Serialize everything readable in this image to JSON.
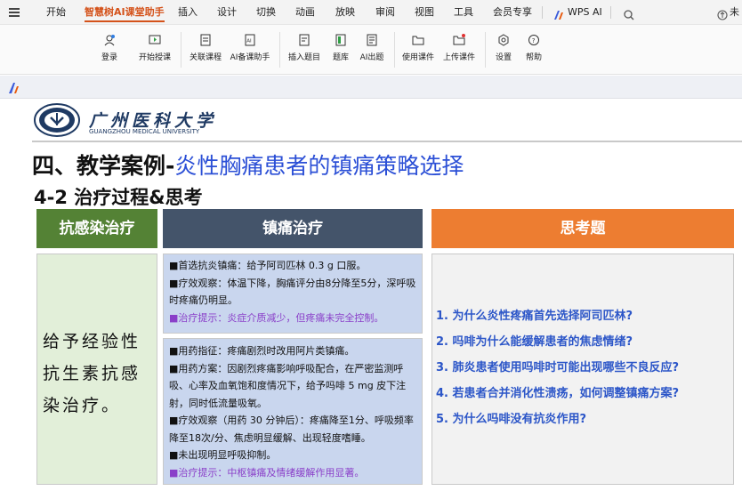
{
  "menu": {
    "tabs": [
      "开始",
      "智慧树AI课堂助手",
      "插入",
      "设计",
      "切换",
      "动画",
      "放映",
      "审阅",
      "视图",
      "工具",
      "会员专享"
    ],
    "wps_ai": "WPS AI",
    "cloud": "未"
  },
  "ribbon": {
    "buttons": [
      "登录",
      "开始授课",
      "关联课程",
      "AI备课助手",
      "插入题目",
      "题库",
      "AI出题",
      "使用课件",
      "上传课件",
      "设置",
      "帮助"
    ]
  },
  "logo": {
    "cn": "广州医科大学",
    "en": "GUANGZHOU MEDICAL UNIVERSITY"
  },
  "slide": {
    "title_black": "四、教学案例-",
    "title_blue": "炎性胸痛患者的镇痛策略选择",
    "subtitle": "4-2 治疗过程&思考",
    "col1": {
      "header": "抗感染治疗",
      "body": "给予经验性抗生素抗感染治疗。"
    },
    "col2": {
      "header": "镇痛治疗",
      "box1": [
        "■首选抗炎镇痛：给予阿司匹林 0.3 g 口服。",
        "■疗效观察：体温下降，胸痛评分由8分降至5分，深呼吸时疼痛仍明显。"
      ],
      "box1_hint": "■治疗提示：炎症介质减少，但疼痛未完全控制。",
      "box2": [
        "■用药指征：疼痛剧烈时改用阿片类镇痛。",
        "■用药方案：因剧烈疼痛影响呼吸配合，在严密监测呼吸、心率及血氧饱和度情况下，给予吗啡 5 mg 皮下注射，同时低流量吸氧。",
        "■疗效观察（用药 30 分钟后）：疼痛降至1分、呼吸频率降至18次/分、焦虑明显缓解、出现轻度嗜睡。",
        "■未出现明显呼吸抑制。"
      ],
      "box2_hint": "■治疗提示：中枢镇痛及情绪缓解作用显著。"
    },
    "col3": {
      "header": "思考题",
      "questions": [
        "1.  为什么炎性疼痛首先选择阿司匹林?",
        "2.  吗啡为什么能缓解患者的焦虑情绪?",
        "3.  肺炎患者使用吗啡时可能出现哪些不良反应?",
        "4.  若患者合并消化性溃疡，如何调整镇痛方案?",
        "5.  为什么吗啡没有抗炎作用?"
      ]
    }
  },
  "colors": {
    "accent_tab": "#d4521a",
    "green_header": "#548235",
    "green_box": "#e2efd9",
    "navy_header": "#44546a",
    "blue_box": "#c9d6ee",
    "orange_header": "#ed7d31",
    "gray_box": "#f2f2f2",
    "question_blue": "#2c56c8",
    "title_blue": "#2b4fd6",
    "hint_purple": "#8a3fc9"
  }
}
